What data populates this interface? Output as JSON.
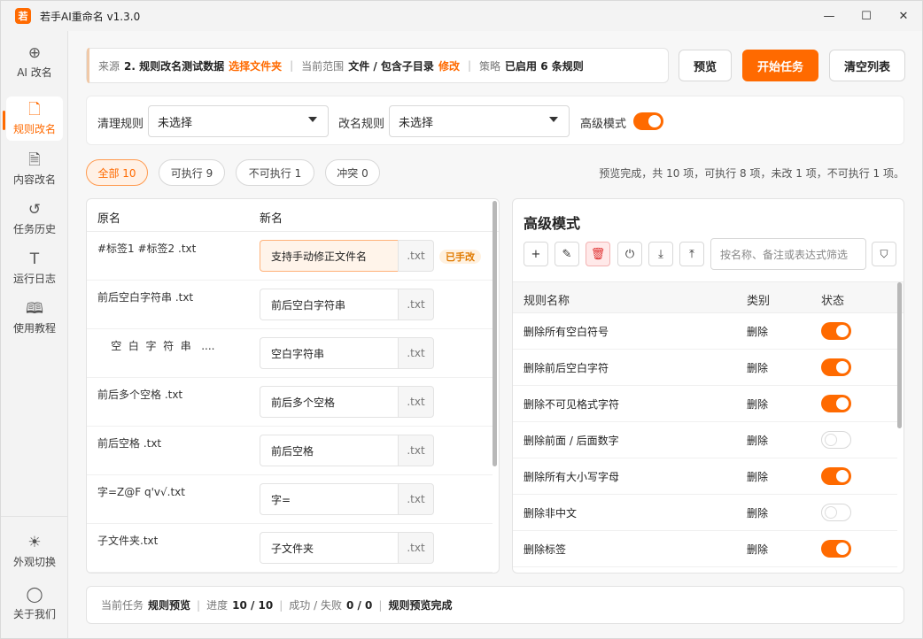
{
  "app": {
    "logo_glyph": "若",
    "title": "若手AI重命名 v1.3.0"
  },
  "window_controls": {
    "minimize": "—",
    "maximize": "☐",
    "close": "✕"
  },
  "sidebar": {
    "items": [
      {
        "icon": "⊕",
        "label": "AI 改名"
      },
      {
        "icon": "🗋",
        "label": "规则改名"
      },
      {
        "icon": "🗎",
        "label": "内容改名"
      },
      {
        "icon": "↺",
        "label": "任务历史"
      },
      {
        "icon": "T",
        "label": "运行日志"
      },
      {
        "icon": "🕮",
        "label": "使用教程"
      },
      {
        "icon": "☀",
        "label": "外观切换"
      },
      {
        "icon": "◯",
        "label": "关于我们"
      }
    ]
  },
  "infobar": {
    "source_label": "来源",
    "source_value": "2. 规则改名测试数据",
    "source_action": "选择文件夹",
    "scope_label": "当前范围",
    "scope_value": "文件 / 包含子目录",
    "scope_action": "修改",
    "strategy_label": "策略",
    "strategy_value": "已启用 6 条规则",
    "separator": "|"
  },
  "actions": {
    "preview": "预览",
    "start": "开始任务",
    "clear": "清空列表"
  },
  "filters": {
    "clean_rule_label": "清理规则",
    "clean_rule_value": "未选择",
    "rename_rule_label": "改名规则",
    "rename_rule_value": "未选择",
    "advanced_label": "高级模式",
    "advanced_on": true
  },
  "chips": [
    {
      "label": "全部 10",
      "active": true
    },
    {
      "label": "可执行 9",
      "active": false
    },
    {
      "label": "不可执行 1",
      "active": false
    },
    {
      "label": "冲突 0",
      "active": false
    }
  ],
  "summary": "预览完成，共 10 项，可执行 8 项，未改 1 项，不可执行 1 项。",
  "file_table": {
    "col_original": "原名",
    "col_new": "新名",
    "rows": [
      {
        "original": "#标签1 #标签2 .txt",
        "new": "支持手动修正文件名",
        "ext": ".txt",
        "badge": "已手改"
      },
      {
        "original": " 前后空白字符串 .txt",
        "new": "前后空白字符串",
        "ext": ".txt",
        "badge": ""
      },
      {
        "original": "    空  白  字  符  串   ....",
        "new": "空白字符串",
        "ext": ".txt",
        "badge": ""
      },
      {
        "original": "前后多个空格 .txt",
        "new": "前后多个空格",
        "ext": ".txt",
        "badge": ""
      },
      {
        "original": "前后空格 .txt",
        "new": "前后空格",
        "ext": ".txt",
        "badge": ""
      },
      {
        "original": "字=Z@F q'v√.txt",
        "new": "字=",
        "ext": ".txt",
        "badge": ""
      },
      {
        "original": "子文件夹.txt",
        "new": "子文件夹",
        "ext": ".txt",
        "badge": ""
      }
    ]
  },
  "advanced": {
    "title": "高级模式",
    "toolbar_icons": [
      "+",
      "✎",
      "🗑",
      "⏻",
      "⤓",
      "⤒"
    ],
    "search_placeholder": "按名称、备注或表达式筛选",
    "filter_icon": "⛉",
    "col_name": "规则名称",
    "col_type": "类别",
    "col_status": "状态",
    "rules": [
      {
        "name": "删除所有空白符号",
        "type": "删除",
        "enabled": true
      },
      {
        "name": "删除前后空白字符",
        "type": "删除",
        "enabled": true
      },
      {
        "name": "删除不可见格式字符",
        "type": "删除",
        "enabled": true
      },
      {
        "name": "删除前面 / 后面数字",
        "type": "删除",
        "enabled": false
      },
      {
        "name": "删除所有大小写字母",
        "type": "删除",
        "enabled": true
      },
      {
        "name": "删除非中文",
        "type": "删除",
        "enabled": false
      },
      {
        "name": "删除标签",
        "type": "删除",
        "enabled": true
      }
    ]
  },
  "status": {
    "task_label": "当前任务",
    "task_value": "规则预览",
    "progress_label": "进度",
    "progress_value": "10 / 10",
    "result_label": "成功 / 失败",
    "result_value": "0 / 0",
    "state": "规则预览完成",
    "separator": "|"
  },
  "colors": {
    "accent": "#ff6a00",
    "danger": "#e03030"
  }
}
